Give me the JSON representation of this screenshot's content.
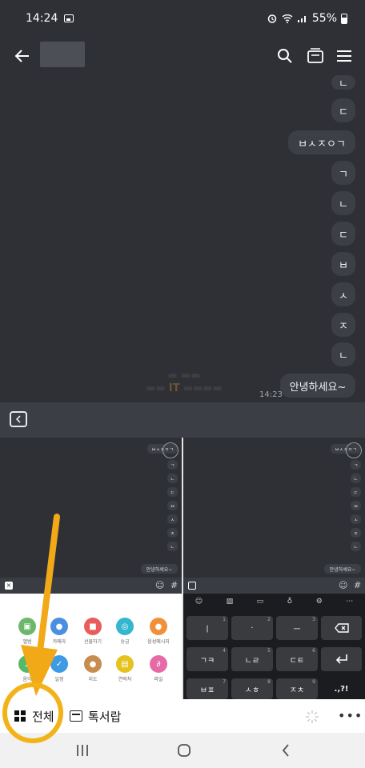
{
  "status_bar": {
    "time": "14:24",
    "battery": "55%"
  },
  "chat": {
    "single_bubbles": [
      "ㄴ",
      "ㄷ",
      "ㄱ",
      "ㄴ",
      "ㄷ",
      "ㅂ",
      "ㅅ",
      "ㅈ",
      "ㄴ"
    ],
    "wide_bubble": "ㅂㅅㅈㅇㄱ",
    "last_message": "안녕하세요~",
    "last_time": "14:23",
    "watermark_it": "IT"
  },
  "mini_panel": {
    "bubbles": [
      "ㅂㅅㅈㅇㄱ",
      "ㄱ",
      "ㄴ",
      "ㄷ",
      "ㅂ",
      "ㅅ",
      "ㅈ",
      "ㄴ"
    ],
    "last_message": "안녕하세요~",
    "hash": "#",
    "x": "×"
  },
  "attachments": [
    {
      "label": "앨범",
      "icon": "album-icon",
      "color": "#6bb86a"
    },
    {
      "label": "카메라",
      "icon": "camera-icon",
      "color": "#4a8fe0"
    },
    {
      "label": "선물하기",
      "icon": "gift-icon",
      "color": "#e85c5c"
    },
    {
      "label": "송금",
      "icon": "send-money-icon",
      "color": "#35b6cf"
    },
    {
      "label": "음성메시지",
      "icon": "voice-icon",
      "color": "#f0913a"
    },
    {
      "label": "음악",
      "icon": "music-icon",
      "color": "#56b96a"
    },
    {
      "label": "일정",
      "icon": "calendar-icon",
      "color": "#3d9be3"
    },
    {
      "label": "지도",
      "icon": "map-icon",
      "color": "#c78d4e"
    },
    {
      "label": "연락처",
      "icon": "contact-icon",
      "color": "#e5c21e"
    },
    {
      "label": "파일",
      "icon": "file-icon",
      "color": "#e76aa7"
    }
  ],
  "keyboard": {
    "rows": [
      [
        {
          "label": "ㅣ",
          "n": "1"
        },
        {
          "label": "·",
          "n": "2"
        },
        {
          "label": "ㅡ",
          "n": "3"
        }
      ],
      [
        {
          "label": "ㄱㅋ",
          "n": "4"
        },
        {
          "label": "ㄴㄹ",
          "n": "5"
        },
        {
          "label": "ㄷㅌ",
          "n": "6"
        }
      ],
      [
        {
          "label": "ㅂㅍ",
          "n": "7"
        },
        {
          "label": "ㅅㅎ",
          "n": "8"
        },
        {
          "label": "ㅈㅊ",
          "n": "9"
        }
      ]
    ],
    "punct": ".,?!"
  },
  "bottom_bar": {
    "all_label": "전체",
    "drawer_label": "톡서랍",
    "more": "•••"
  },
  "accent_colors": {
    "highlight": "#f2b318",
    "arrow": "#f2a917"
  }
}
